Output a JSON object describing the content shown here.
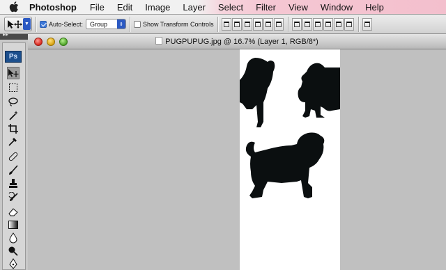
{
  "menubar": {
    "items": [
      "Photoshop",
      "File",
      "Edit",
      "Image",
      "Layer",
      "Select",
      "Filter",
      "View",
      "Window",
      "Help"
    ]
  },
  "options_bar": {
    "auto_select_label": "Auto-Select:",
    "auto_select_checked": true,
    "auto_select_value": "Group",
    "show_transform_label": "Show Transform Controls",
    "show_transform_checked": false
  },
  "tools_panel": {
    "logo": "Ps",
    "tools": [
      "move-tool",
      "marquee-tool",
      "lasso-tool",
      "magic-wand-tool",
      "crop-tool",
      "eyedropper-tool",
      "healing-brush-tool",
      "brush-tool",
      "clone-stamp-tool",
      "history-brush-tool",
      "eraser-tool",
      "gradient-tool",
      "blur-tool",
      "dodge-tool",
      "pen-tool"
    ]
  },
  "document": {
    "title": "PUGPUPUG.jpg @ 16.7% (Layer 1, RGB/8*)"
  },
  "colors": {
    "accent": "#2b59c3",
    "canvas_bg": "#c0c0c0",
    "silhouette": "#0b0f10"
  }
}
